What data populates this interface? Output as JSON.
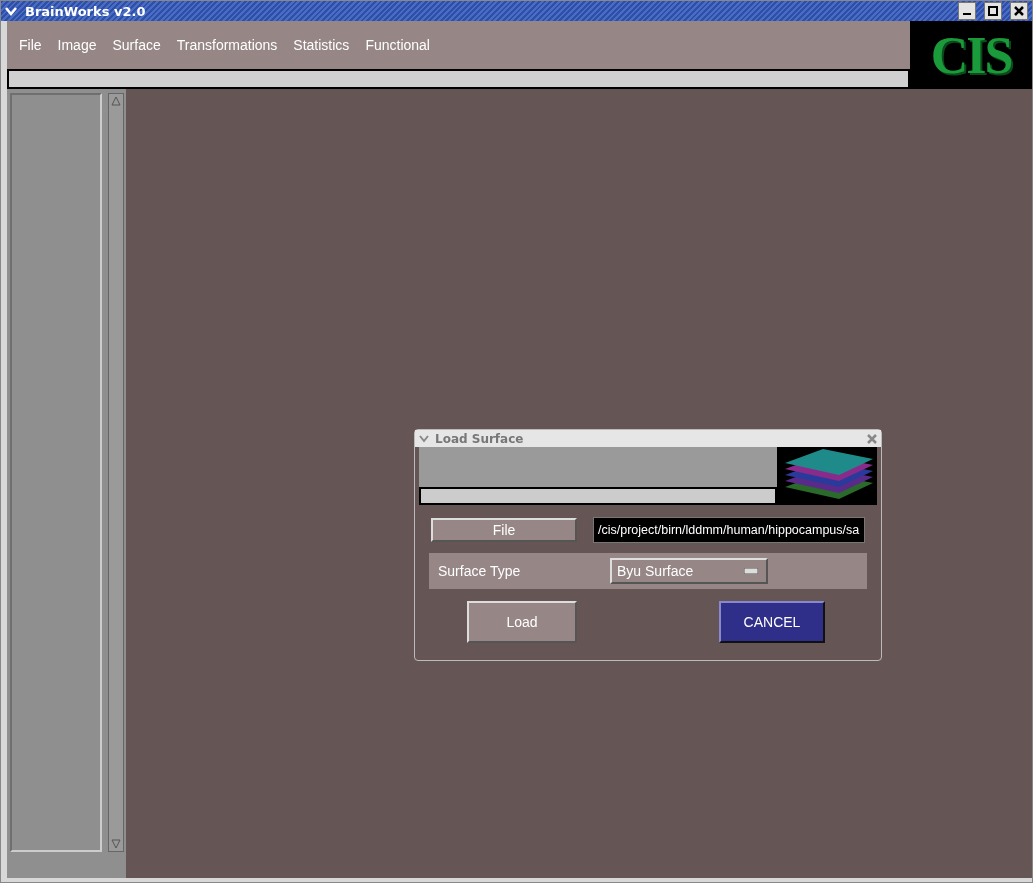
{
  "window": {
    "title": "BrainWorks v2.0"
  },
  "menu": [
    "File",
    "Image",
    "Surface",
    "Transformations",
    "Statistics",
    "Functional"
  ],
  "logo": {
    "text": "CIS"
  },
  "dialog": {
    "title": "Load Surface",
    "file_button": "File",
    "file_path": "/cis/project/birn/lddmm/human/hippocampus/sa",
    "surface_type_label": "Surface Type",
    "surface_type": "Byu Surface",
    "buttons": [
      {
        "label": "Load",
        "kind": "normal"
      },
      {
        "label": "CANCEL",
        "kind": "default"
      }
    ]
  }
}
